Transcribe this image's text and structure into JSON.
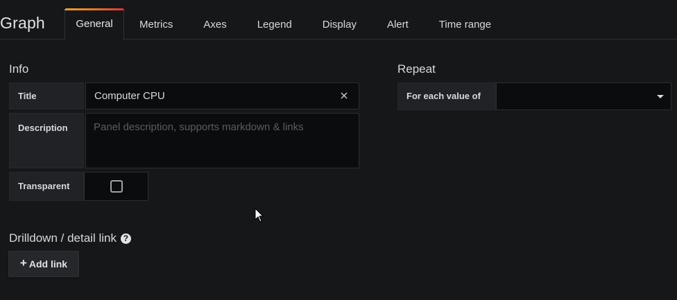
{
  "header": {
    "panel_type": "Graph",
    "tabs": [
      {
        "label": "General",
        "active": true
      },
      {
        "label": "Metrics",
        "active": false
      },
      {
        "label": "Axes",
        "active": false
      },
      {
        "label": "Legend",
        "active": false
      },
      {
        "label": "Display",
        "active": false
      },
      {
        "label": "Alert",
        "active": false
      },
      {
        "label": "Time range",
        "active": false
      }
    ]
  },
  "info": {
    "heading": "Info",
    "title_label": "Title",
    "title_value": "Computer CPU",
    "description_label": "Description",
    "description_placeholder": "Panel description, supports markdown & links",
    "transparent_label": "Transparent",
    "transparent_checked": false
  },
  "repeat": {
    "heading": "Repeat",
    "for_each_label": "For each value of",
    "for_each_value": ""
  },
  "drilldown": {
    "heading": "Drilldown / detail link",
    "add_link_label": "Add link"
  },
  "icons": {
    "clear": "close-icon",
    "dropdown": "caret-down-icon",
    "help": "question-circle-icon",
    "add": "plus-icon"
  },
  "colors": {
    "background": "#161719",
    "accent_gradient": [
      "#f2a12a",
      "#eb7b18",
      "#e02f44"
    ]
  }
}
